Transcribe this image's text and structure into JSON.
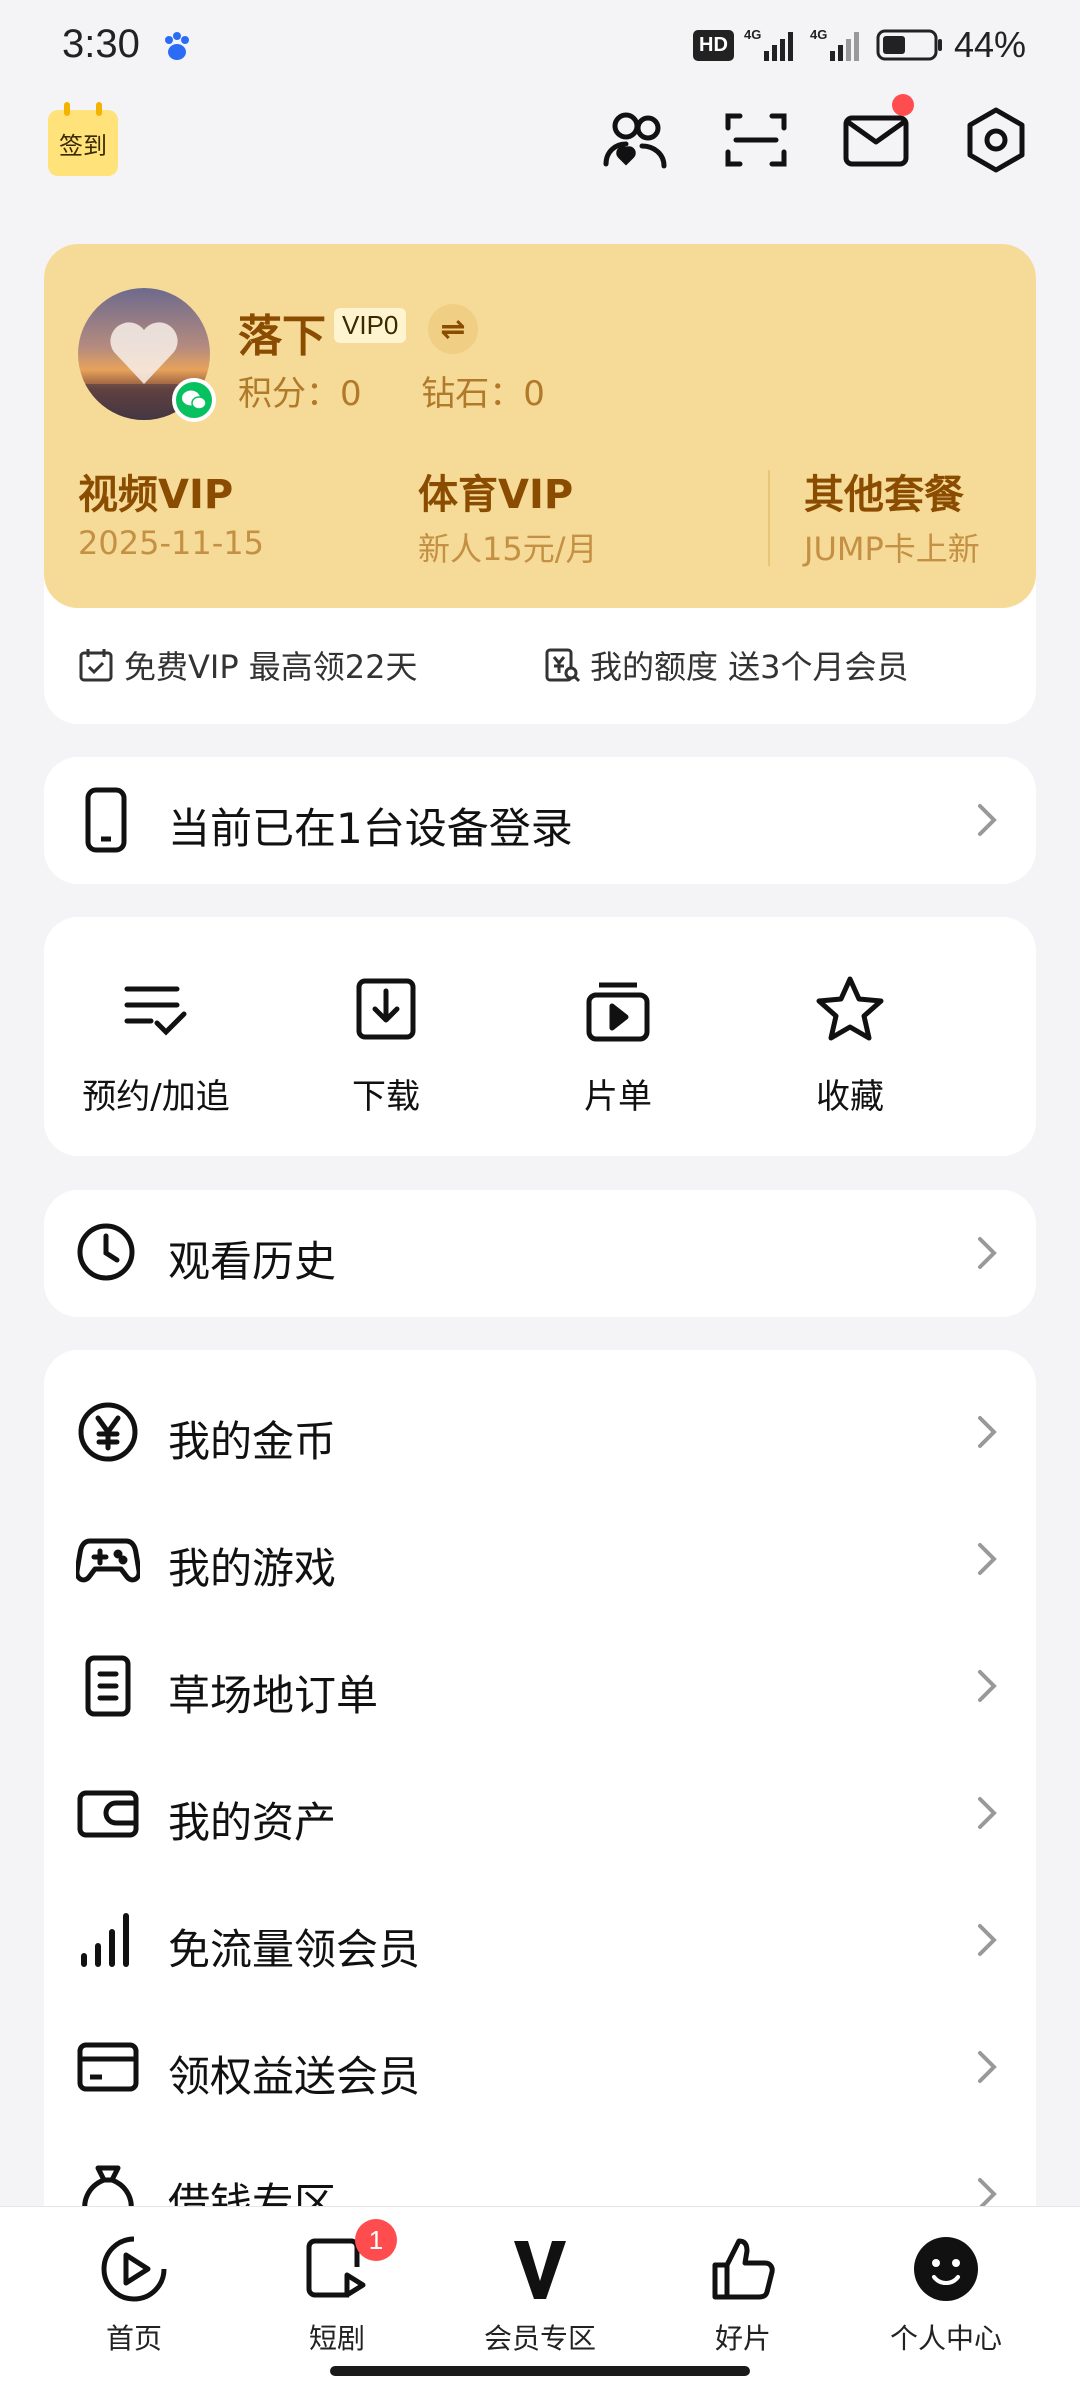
{
  "status_bar": {
    "time": "3:30",
    "hd": "HD",
    "net1": "4G",
    "net2": "4G",
    "battery": "44%"
  },
  "top": {
    "signin_label": "签到"
  },
  "profile": {
    "username": "落下",
    "vip_level": "VIP0",
    "points_label": "积分：0",
    "diamonds_label": "钻石：0"
  },
  "vip_columns": [
    {
      "title": "视频VIP",
      "sub": "2025-11-15"
    },
    {
      "title": "体育VIP",
      "sub": "新人15元/月"
    },
    {
      "title": "其他套餐",
      "sub": "JUMP卡上新"
    }
  ],
  "vip_bottom": {
    "left": "免费VIP 最高领22天",
    "right": "我的额度 送3个月会员"
  },
  "device_row": {
    "label": "当前已在1台设备登录"
  },
  "quick_actions": [
    {
      "label": "预约/加追",
      "icon": "list-check-icon"
    },
    {
      "label": "下载",
      "icon": "download-icon"
    },
    {
      "label": "片单",
      "icon": "playlist-icon"
    },
    {
      "label": "收藏",
      "icon": "star-icon"
    }
  ],
  "history_row": {
    "label": "观看历史"
  },
  "menu": [
    {
      "label": "我的金币",
      "icon": "yen-coin-icon"
    },
    {
      "label": "我的游戏",
      "icon": "gamepad-icon"
    },
    {
      "label": "草场地订单",
      "icon": "order-icon"
    },
    {
      "label": "我的资产",
      "icon": "wallet-icon"
    },
    {
      "label": "免流量领会员",
      "icon": "signal-bars-icon"
    },
    {
      "label": "领权益送会员",
      "icon": "card-icon"
    },
    {
      "label": "借钱专区",
      "icon": "money-bag-icon"
    }
  ],
  "bottom_nav": [
    {
      "label": "首页",
      "icon": "home-play-icon"
    },
    {
      "label": "短剧",
      "icon": "short-drama-icon",
      "badge": "1"
    },
    {
      "label": "会员专区",
      "icon": "vip-v-icon"
    },
    {
      "label": "好片",
      "icon": "thumbs-up-icon"
    },
    {
      "label": "个人中心",
      "icon": "profile-face-icon"
    }
  ],
  "colors": {
    "vip_card": "#f6da98",
    "vip_text": "#8a4c00",
    "badge_red": "#ff4d4f",
    "wechat_green": "#07c160"
  }
}
